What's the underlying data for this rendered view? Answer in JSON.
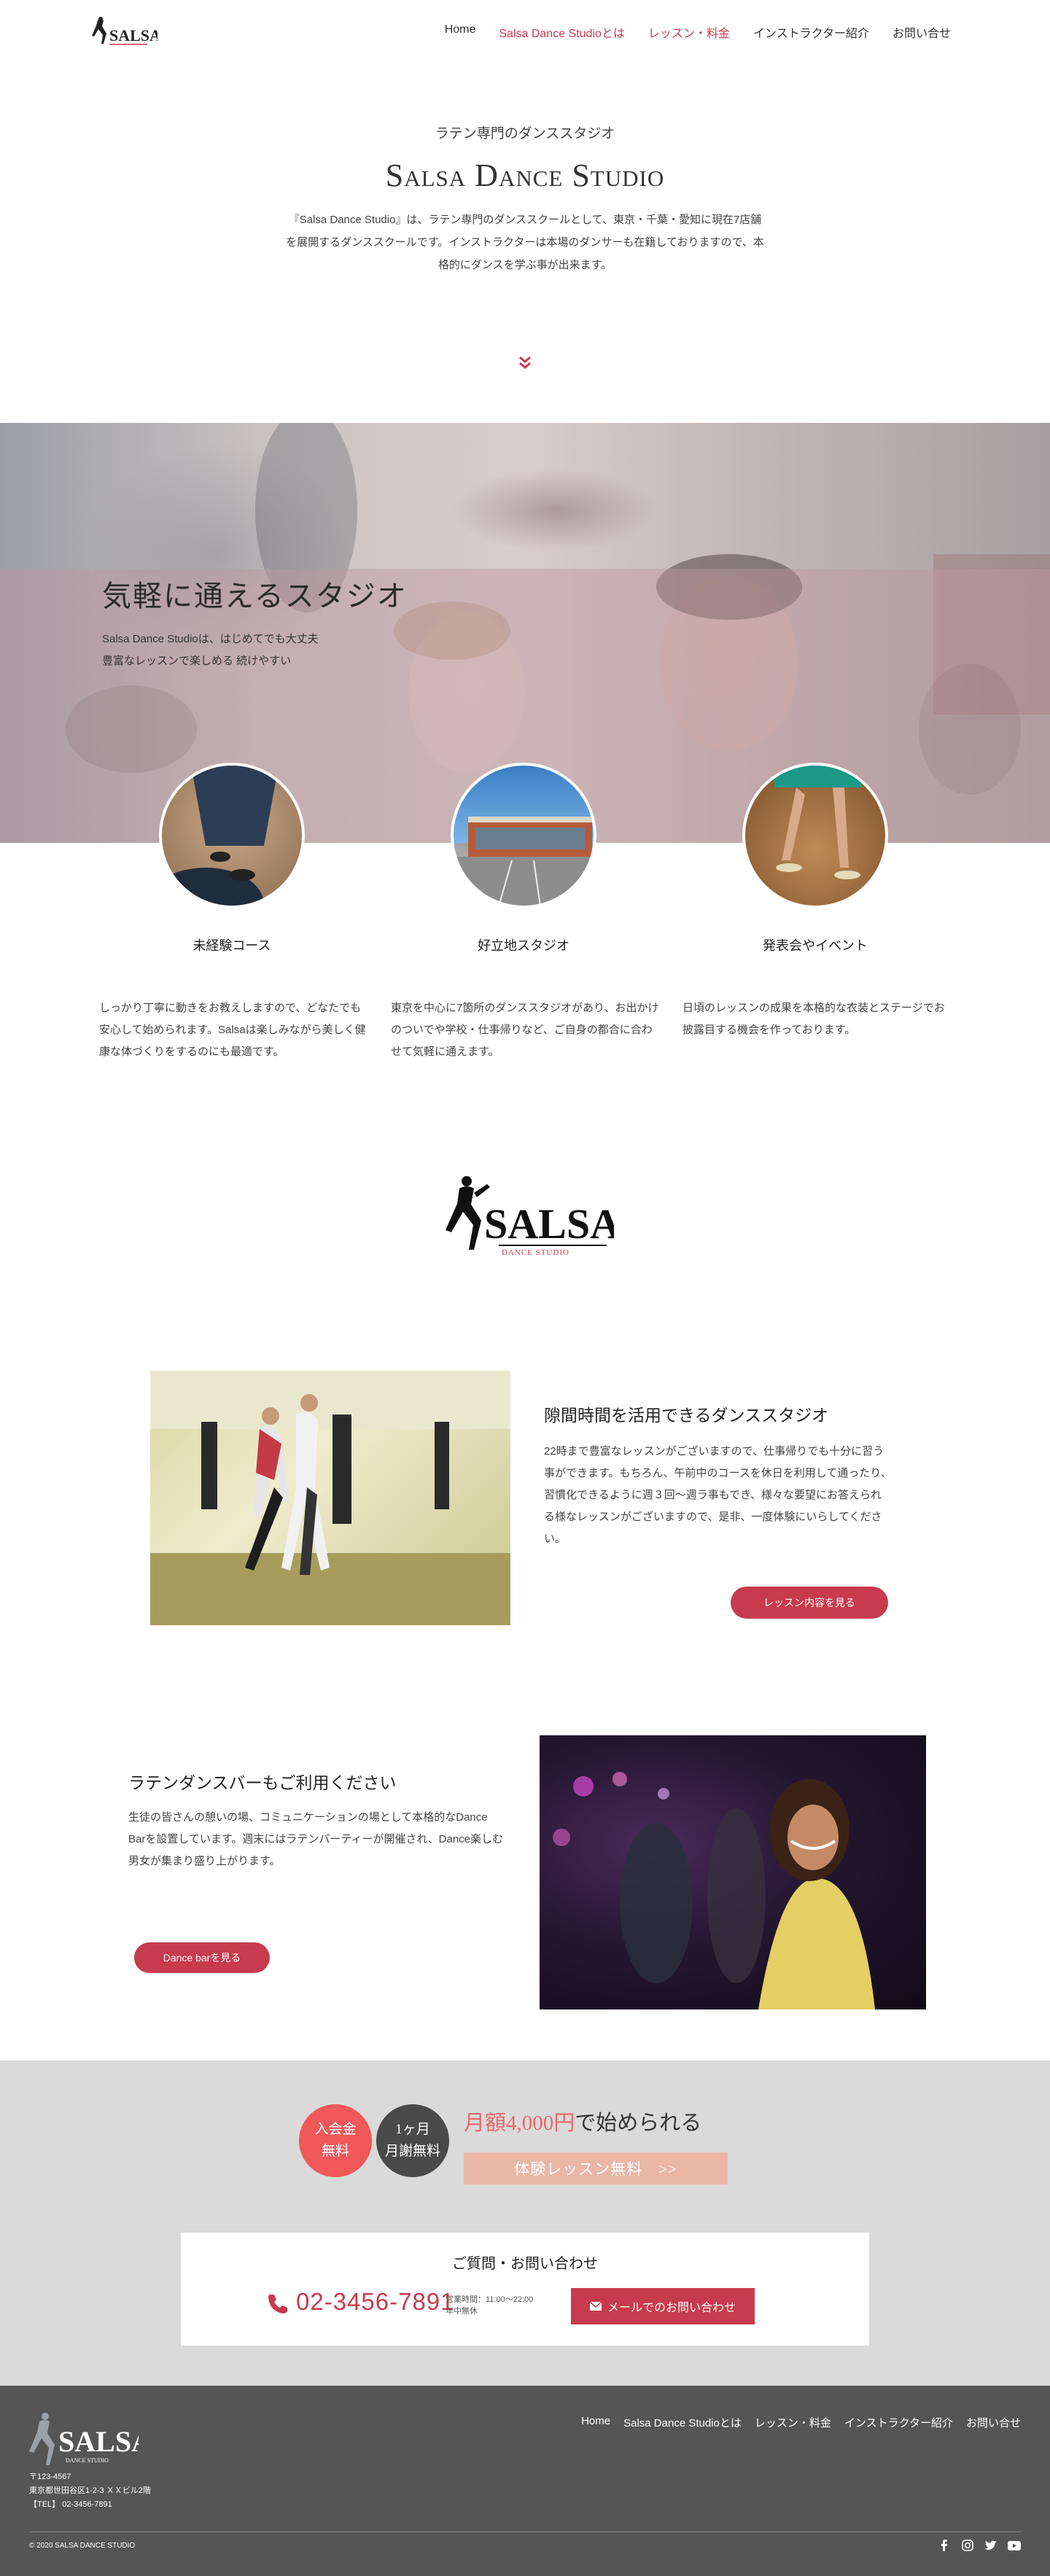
{
  "header": {
    "logo_text": "SALSA",
    "nav": [
      {
        "label": "Home"
      },
      {
        "label": "Salsa Dance Studioとは"
      },
      {
        "label": "レッスン・料金"
      },
      {
        "label": "インストラクター紹介"
      },
      {
        "label": "お問い合せ"
      }
    ]
  },
  "intro": {
    "eyebrow": "ラテン専門のダンススタジオ",
    "title": "Salsa Dance Studio",
    "text": "『Salsa Dance Studio』は、ラテン専門のダンススクールとして、東京・千葉・愛知に現在7店舗を展開するダンススクールです。インストラクターは本場のダンサーも在籍しておりますので、本格的にダンスを学ぶ事が出来ます。"
  },
  "hero": {
    "title": "気軽に通えるスタジオ",
    "text_line1": "Salsa Dance Studioは、はじめてでも大丈夫",
    "text_line2": "豊富なレッスンで楽しめる 続けやすい"
  },
  "features": [
    {
      "title": "未経験コース",
      "text": "しっかり丁寧に動きをお教えしますので、どなたでも安心して始められます。Salsaは楽しみながら美しく健康な体づくりをするのにも最適です。"
    },
    {
      "title": "好立地スタジオ",
      "text": "東京を中心に7箇所のダンススタジオがあり、お出かけのついでや学校・仕事帰りなど、ご自身の都合に合わせて気軽に通えます。"
    },
    {
      "title": "発表会やイベント",
      "text": "日頃のレッスンの成果を本格的な衣装とステージでお披露目する機会を作っております。"
    }
  ],
  "mid_logo": {
    "text": "SALSA",
    "sub": "DANCE STUDIO"
  },
  "block1": {
    "title": "隙間時間を活用できるダンススタジオ",
    "text": "22時まで豊富なレッスンがございますので、仕事帰りでも十分に習う事ができます。もちろん、午前中のコースを休日を利用して通ったり、習慣化できるように週３回〜週ラ事もでき、様々な要望にお答えられる様なレッスンがございますので、是非、一度体験にいらしてください。",
    "button": "レッスン内容を見る"
  },
  "block2": {
    "title": "ラテンダンスバーもご利用ください",
    "text": "生徒の皆さんの憩いの場、コミュニケーションの場として本格的なDance Barを設置しています。週末にはラテンパーティーが開催され、Dance楽しむ男女が集まり盛り上がります。",
    "button": "Dance barを見る"
  },
  "cta": {
    "badge_join_line1": "入会金",
    "badge_join_line2": "無料",
    "badge_month_line1": "1ヶ月",
    "badge_month_line2": "月謝無料",
    "price_red": "月額4,000円",
    "price_rest": "で始められる",
    "trial": "体験レッスン無料　>>",
    "contact_title": "ご質問・お問い合わせ",
    "phone": "02-3456-7891",
    "hours_line1": "営業時間：11:00〜22:00",
    "hours_line2": "年中無休",
    "mail_button": "メールでのお問い合わせ"
  },
  "footer": {
    "logo_text": "SALSA",
    "logo_sub": "DANCE STUDIO",
    "nav": [
      {
        "label": "Home"
      },
      {
        "label": "Salsa Dance Studioとは"
      },
      {
        "label": "レッスン・料金"
      },
      {
        "label": "インストラクター紹介"
      },
      {
        "label": "お問い合せ"
      }
    ],
    "address_line1": "〒123-4567",
    "address_line2": "東京都世田谷区1-2-3 ＸＸビル2階",
    "address_line3": "【TEL】 02-3456-7891",
    "copyright": "© 2020 SALSA DANCE STUDIO"
  },
  "colors": {
    "accent": "#c83a4d",
    "coral": "#f0585a",
    "dark": "#4a4a4a",
    "footer": "#555555",
    "cta_bg": "#dadada"
  }
}
